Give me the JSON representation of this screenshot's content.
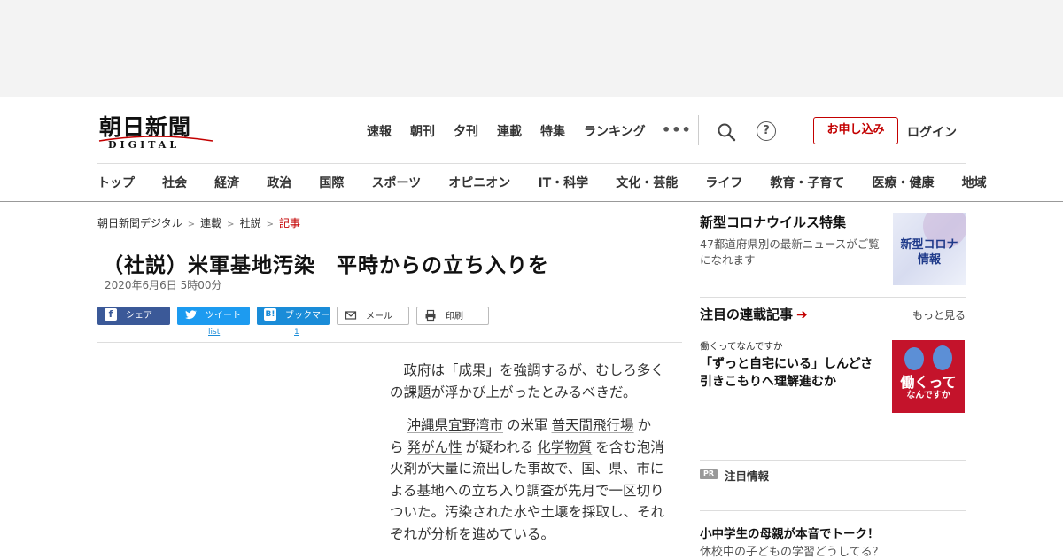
{
  "header": {
    "logo_main": "朝日新聞",
    "logo_sub": "DIGITAL",
    "topnav": [
      "速報",
      "朝刊",
      "夕刊",
      "連載",
      "特集",
      "ランキング"
    ],
    "more": "•••",
    "help": "?",
    "subscribe": "お申し込み",
    "login": "ログイン"
  },
  "categories": [
    "トップ",
    "社会",
    "経済",
    "政治",
    "国際",
    "スポーツ",
    "オピニオン",
    "IT・科学",
    "文化・芸能",
    "ライフ",
    "教育・子育て",
    "医療・健康",
    "地域"
  ],
  "breadcrumb": {
    "items": [
      "朝日新聞デジタル",
      "連載",
      "社説"
    ],
    "current": "記事",
    "separator": ">"
  },
  "article": {
    "title": "（社説）米軍基地汚染　平時からの立ち入りを",
    "date": "2020年6月6日 5時00分",
    "paragraphs": [
      {
        "text": "政府は「成果」を強調するが、むしろ多くの課題が浮かび上がったとみるべきだ。"
      },
      {
        "p2_a": "沖縄県宜野湾市",
        "p2_b": "の米軍",
        "p2_c": "普天間飛行場",
        "p2_d": "から",
        "p2_e": "発がん性",
        "p2_f": "が疑われる",
        "p2_g": "化学物質",
        "p2_h": "を含む泡消火剤が大量に流出した事故で、国、県、市による基地への立ち入り調査が先月で一区切りついた。汚染された水や土壌を採取し、それぞれが分析を進めている。"
      }
    ]
  },
  "share": {
    "facebook": "シェア",
    "twitter": "ツイート",
    "twitter_count": "list",
    "hatena": "ブックマーク",
    "hatena_count": "1",
    "mail": "メール",
    "print": "印刷"
  },
  "sidebar": {
    "corona": {
      "title": "新型コロナウイルス特集",
      "desc": "47都道府県別の最新ニュースがご覧になれます",
      "image_label_1": "新型コロナ",
      "image_label_2": "情報"
    },
    "series": {
      "heading": "注目の連載記事",
      "arrow": "➔",
      "more": "もっと見る",
      "tag": "働くってなんですか",
      "headline": "「ずっと自宅にいる」しんどさ　引きこもりへ理解進むか",
      "image_label_1": "働くって",
      "image_label_2": "なんですか"
    },
    "pr": {
      "badge": "PR",
      "label": "注目情報",
      "headline": "小中学生の母親が本音でトーク！",
      "sub": "休校中の子どもの学習どうしてる？"
    }
  },
  "colors": {
    "accent_red": "#c30000",
    "facebook": "#3b5998",
    "twitter": "#1d9bf0",
    "hatena": "#1a8cd8",
    "series_image_bg": "#c4132b"
  }
}
